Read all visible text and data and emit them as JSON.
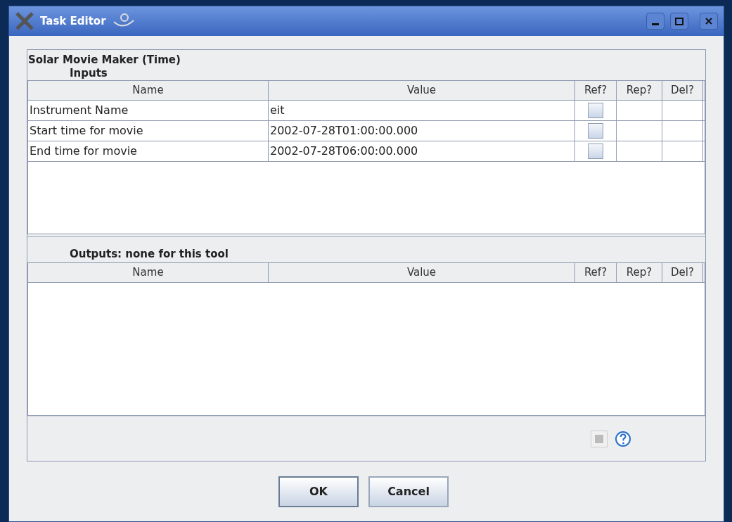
{
  "window": {
    "title": "Task Editor"
  },
  "tool_title": "Solar Movie Maker (Time)",
  "inputs": {
    "label": "Inputs",
    "columns": [
      "Name",
      "Value",
      "Ref?",
      "Rep?",
      "Del?"
    ],
    "rows": [
      {
        "name": "Instrument Name",
        "value": "eit",
        "ref_checked": false
      },
      {
        "name": "Start time for movie",
        "value": "2002-07-28T01:00:00.000",
        "ref_checked": false
      },
      {
        "name": "End time for movie",
        "value": "2002-07-28T06:00:00.000",
        "ref_checked": false
      }
    ]
  },
  "outputs": {
    "label": "Outputs: none for this tool",
    "columns": [
      "Name",
      "Value",
      "Ref?",
      "Rep?",
      "Del?"
    ]
  },
  "buttons": [
    "OK",
    "Cancel"
  ]
}
